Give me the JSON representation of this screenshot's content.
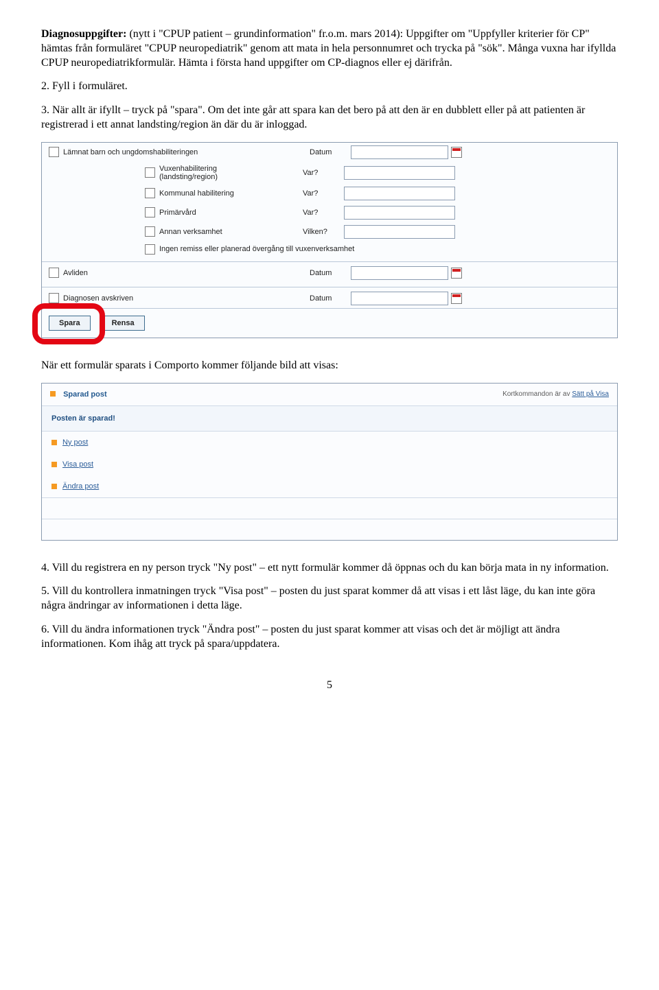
{
  "p1_bold": "Diagnosuppgifter:",
  "p1_rest": " (nytt i \"CPUP patient – grundinformation\" fr.o.m. mars 2014): Uppgifter om \"Uppfyller kriterier för CP\" hämtas från formuläret \"CPUP neuropediatrik\" genom att mata in hela personnumret och trycka på \"sök\". Många vuxna har ifyllda CPUP neuropediatrikformulär. Hämta i första hand uppgifter om CP-diagnos eller ej därifrån.",
  "p2": "2. Fyll i formuläret.",
  "p3": "3. När allt är ifyllt – tryck på \"spara\". Om det inte går att spara kan det bero på att den är en dubblett eller på att patienten är registrerad i ett annat landsting/region än där du är inloggad.",
  "form": {
    "lamnat": "Lämnat barn och ungdomshabiliteringen",
    "datum": "Datum",
    "vuxen1": "Vuxenhabilitering",
    "vuxen2": "(landsting/region)",
    "kommunal": "Kommunal habilitering",
    "primarvard": "Primärvård",
    "annan": "Annan verksamhet",
    "ingen": "Ingen remiss eller planerad övergång till vuxenverksamhet",
    "var": "Var?",
    "vilken": "Vilken?",
    "avliden": "Avliden",
    "diagnosen": "Diagnosen avskriven",
    "spara": "Spara",
    "rensa": "Rensa"
  },
  "between": "När ett formulär sparats i Comporto kommer följande bild att visas:",
  "s2": {
    "title": "Sparad post",
    "kort": "Kortkommandon är av ",
    "kort_link": "Sätt på Visa",
    "banner": "Posten är sparad!",
    "ny": "Ny post",
    "visa": "Visa post",
    "andra": "Ändra post"
  },
  "p4": "4. Vill du registrera en ny person tryck \"Ny post\" – ett nytt formulär kommer då öppnas och du kan börja mata in ny information.",
  "p5": "5. Vill du kontrollera inmatningen tryck \"Visa post\" – posten du just sparat kommer då att visas i ett låst läge, du kan inte göra några ändringar av informationen i detta läge.",
  "p6": "6. Vill du ändra informationen tryck \"Ändra post\" – posten du just sparat kommer att visas och det är möjligt att ändra informationen. Kom ihåg att tryck på spara/uppdatera.",
  "page": "5"
}
